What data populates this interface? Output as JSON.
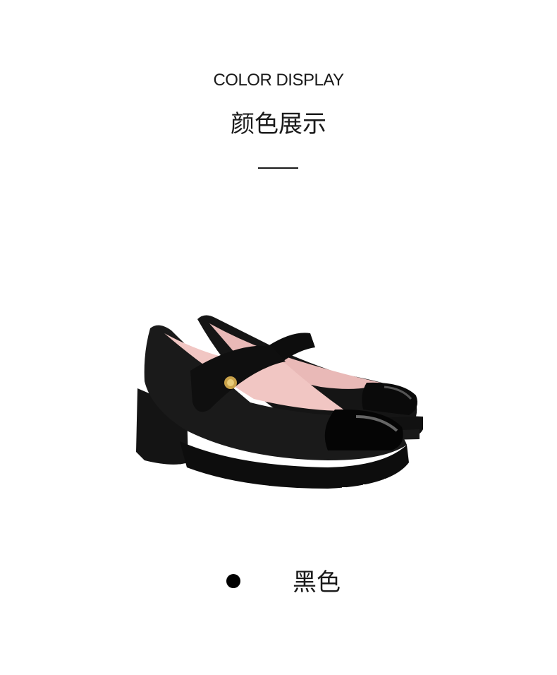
{
  "section": {
    "title_en": "COLOR DISPLAY",
    "title_cn": "颜色展示"
  },
  "product": {
    "image_icon": "black-mary-jane-shoes",
    "colors": [
      {
        "name": "黑色",
        "swatch": "#000000"
      }
    ]
  }
}
